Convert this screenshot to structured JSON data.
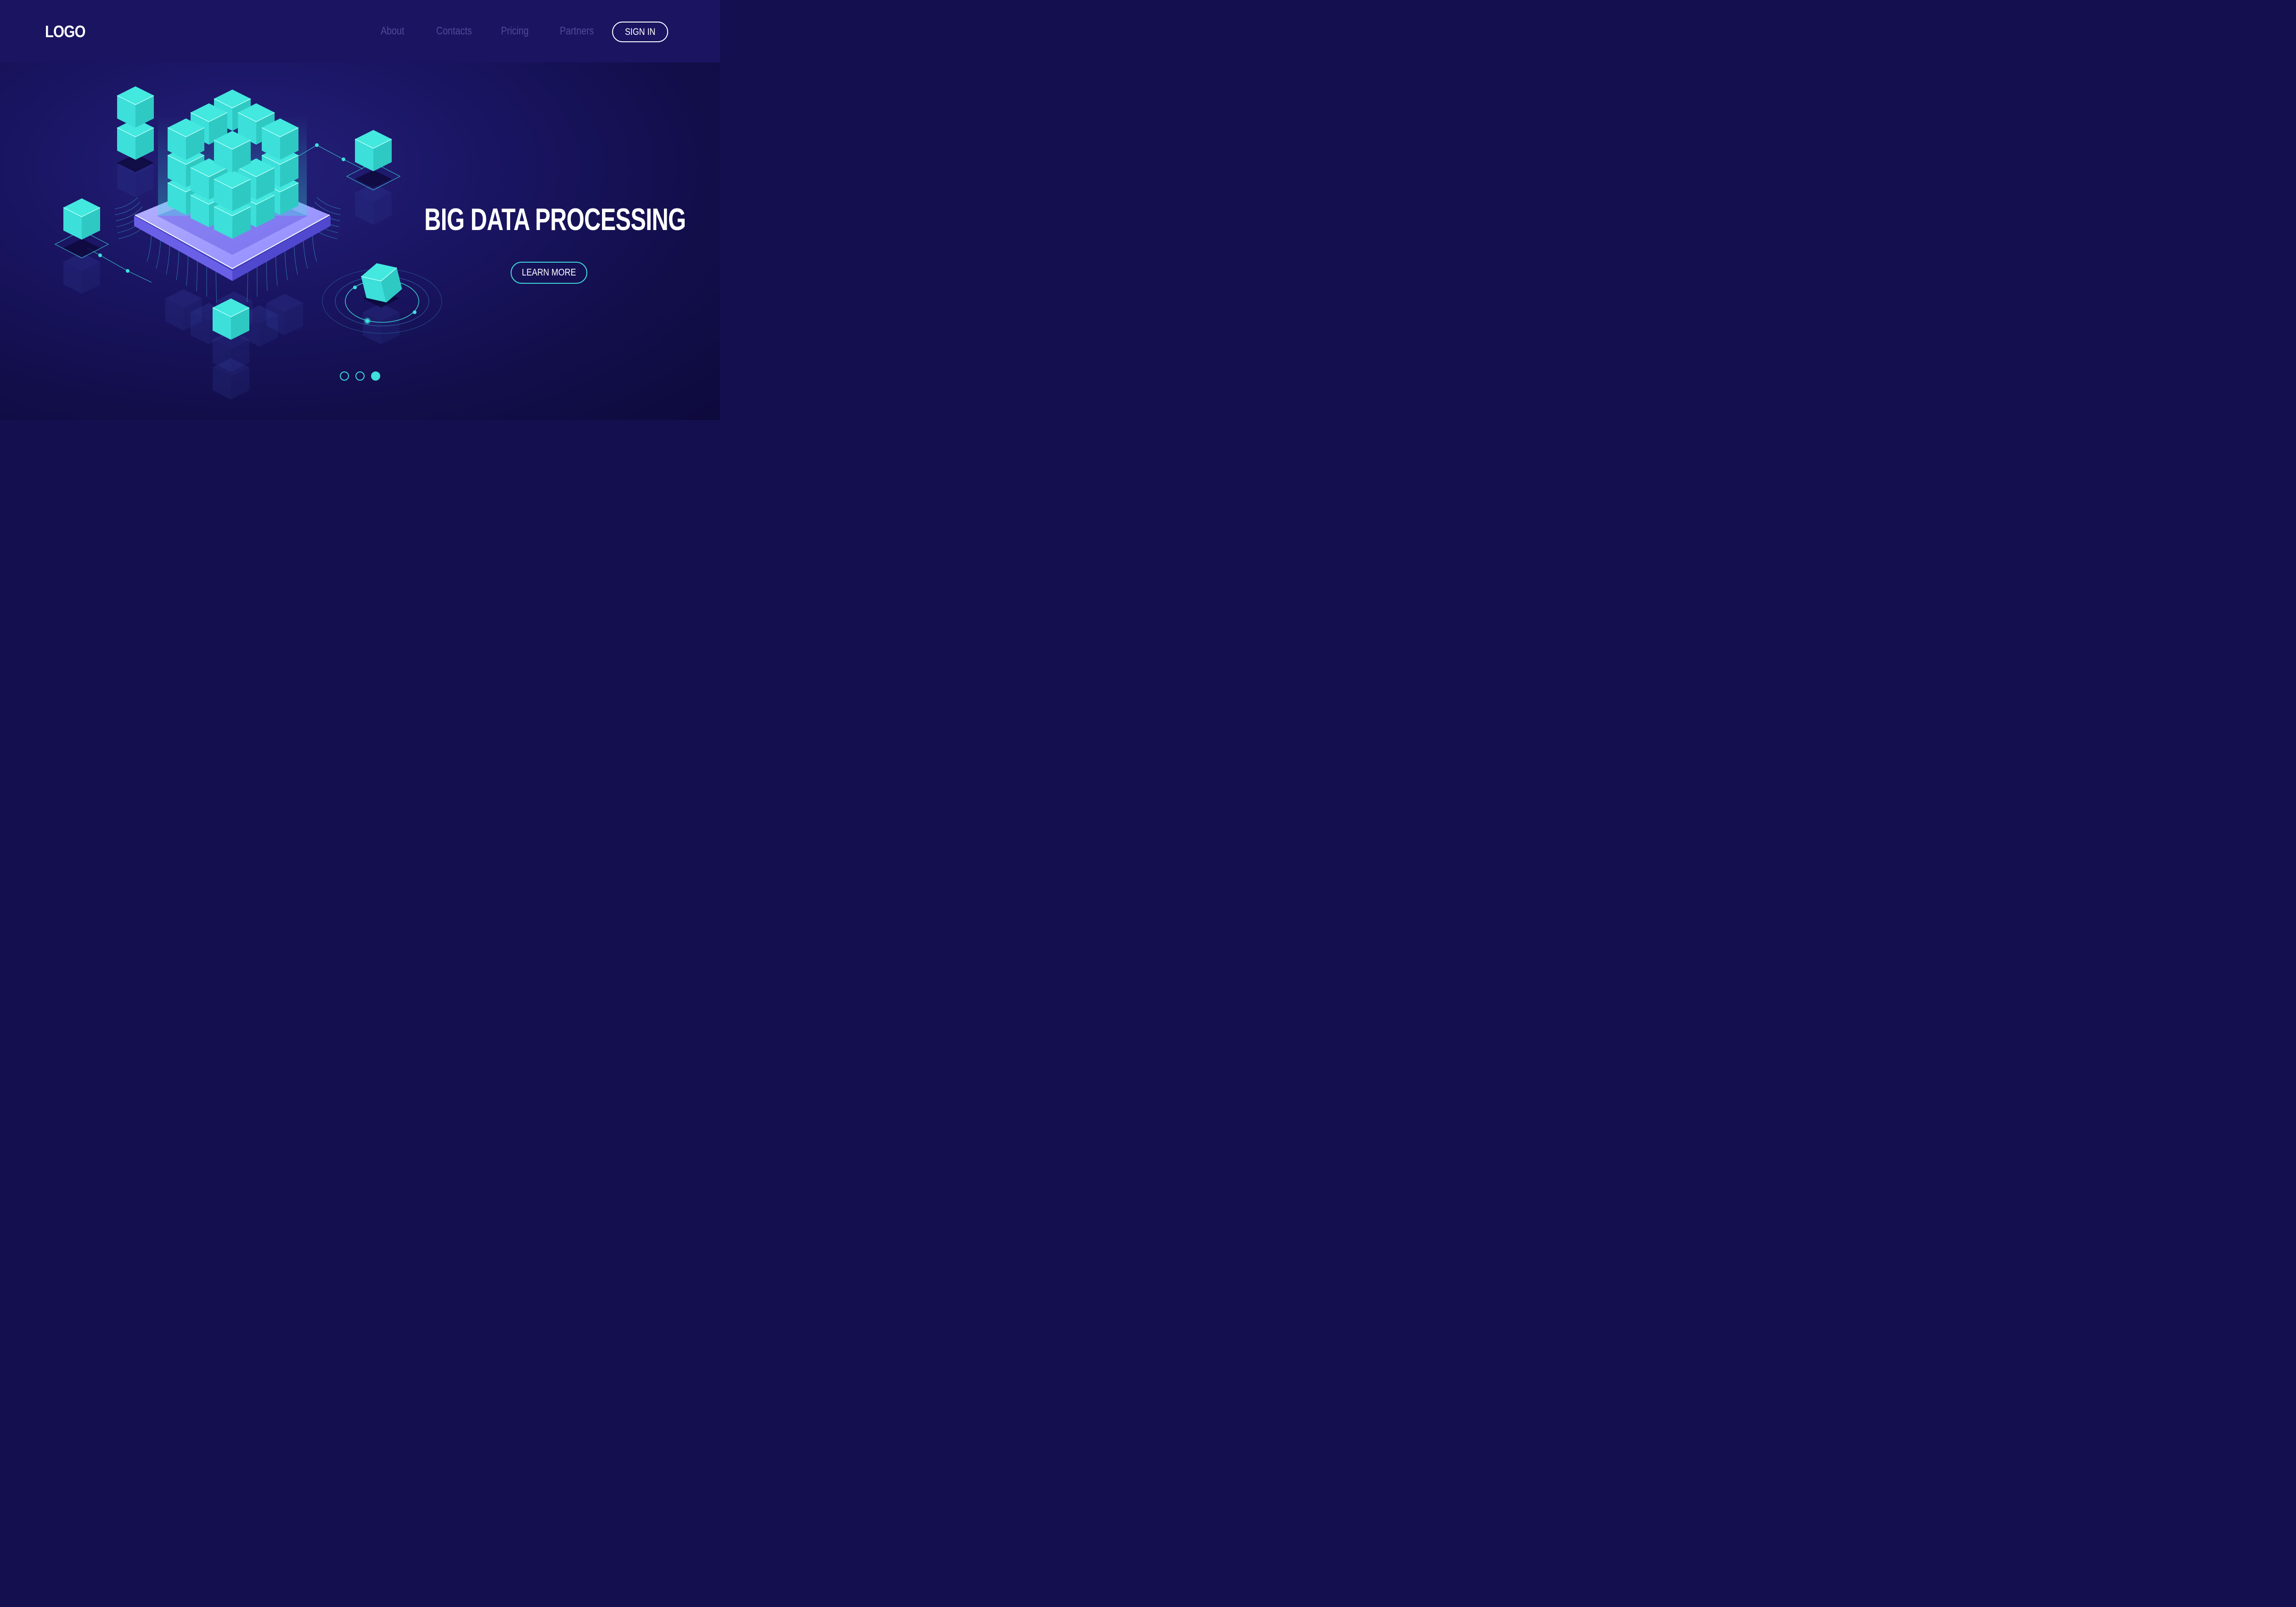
{
  "header": {
    "logo": "LOGO",
    "nav": [
      {
        "label": "About"
      },
      {
        "label": "Contacts"
      },
      {
        "label": "Pricing"
      },
      {
        "label": "Partners"
      }
    ],
    "signin_label": "SIGN IN"
  },
  "hero": {
    "headline": "BIG DATA PROCESSING",
    "cta_label": "LEARN MORE"
  },
  "carousel": {
    "slide_count": 3,
    "active_index": 2
  },
  "colors": {
    "background": "#141050",
    "header": "#1a1461",
    "accent": "#3fe0dc",
    "nav_text": "#4f4b98",
    "text": "#ffffff"
  },
  "icons": [
    "big-data-isometric-illustration",
    "server-chip-icon",
    "data-cube-icon",
    "orbit-ring-icon"
  ]
}
